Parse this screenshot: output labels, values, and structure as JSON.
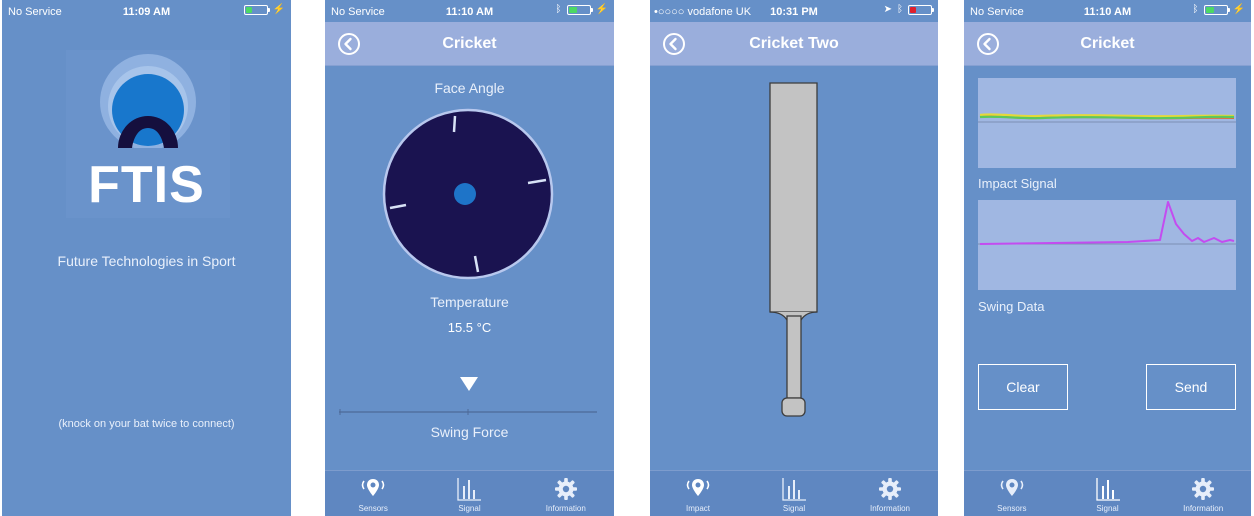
{
  "screens": {
    "splash": {
      "status": {
        "carrier": "No Service",
        "time": "11:09 AM"
      },
      "logo_text": "FTIS",
      "tagline": "Future Technologies in Sport",
      "hint": "(knock on your bat twice to connect)"
    },
    "face": {
      "status": {
        "carrier": "No Service",
        "time": "11:10 AM"
      },
      "nav_title": "Cricket",
      "face_angle_label": "Face Angle",
      "temperature_label": "Temperature",
      "temperature_value": "15.5 °C",
      "swing_force_label": "Swing Force",
      "tabs": [
        "Sensors",
        "Signal",
        "Information"
      ]
    },
    "bat": {
      "status": {
        "carrier": "•○○○○ vodafone UK",
        "time": "10:31 PM"
      },
      "nav_title": "Cricket Two",
      "tabs": [
        "Impact",
        "Signal",
        "Information"
      ]
    },
    "signal": {
      "status": {
        "carrier": "No Service",
        "time": "11:10 AM"
      },
      "nav_title": "Cricket",
      "impact_label": "Impact Signal",
      "swing_label": "Swing Data",
      "clear_label": "Clear",
      "send_label": "Send",
      "tabs": [
        "Sensors",
        "Signal",
        "Information"
      ]
    }
  },
  "colors": {
    "background": "#6690c8",
    "navbar": "#9aaedc",
    "tabbar": "#5f87c1",
    "dial": "#1a1350",
    "dial_center": "#1e74c8",
    "battery_charging": "#4cd964",
    "battery_low": "#e0202c",
    "swing_trace": "#c34cf0"
  },
  "icons": {
    "sensors": "location-signal-icon",
    "signal": "bar-chart-icon",
    "information": "gear-icon",
    "back": "back-circle-icon"
  }
}
